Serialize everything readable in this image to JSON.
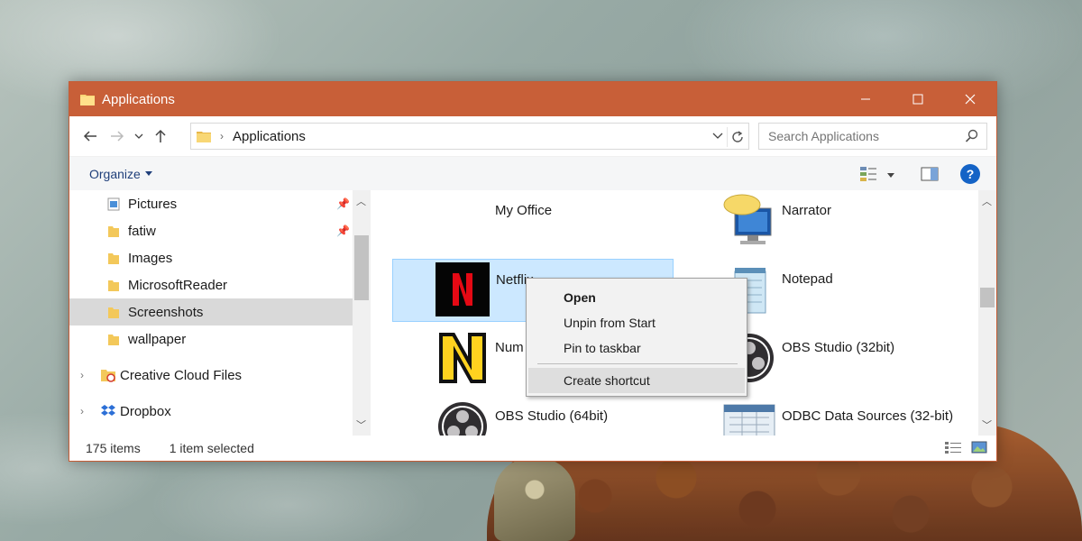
{
  "window": {
    "title": "Applications",
    "accent": "#c85f38"
  },
  "nav": {
    "back_icon": "back-arrow-icon",
    "forward_icon": "forward-arrow-icon",
    "recent_icon": "chevron-down-icon",
    "up_icon": "up-arrow-icon",
    "address_crumb": "Applications",
    "search_placeholder": "Search Applications"
  },
  "command_bar": {
    "organize_label": "Organize"
  },
  "sidebar": {
    "items": [
      {
        "label": "Pictures",
        "pinned": true
      },
      {
        "label": "fatiw",
        "pinned": true
      },
      {
        "label": "Images",
        "pinned": false
      },
      {
        "label": "MicrosoftReader",
        "pinned": false
      },
      {
        "label": "Screenshots",
        "pinned": false,
        "selected": true
      },
      {
        "label": "wallpaper",
        "pinned": false
      }
    ],
    "roots": [
      {
        "label": "Creative Cloud Files"
      },
      {
        "label": "Dropbox"
      }
    ]
  },
  "content": {
    "tiles": [
      {
        "label": "My Office",
        "icon": "none"
      },
      {
        "label": "Narrator",
        "icon": "narrator-icon"
      },
      {
        "label": "Netflix",
        "icon": "netflix-icon",
        "selected": true
      },
      {
        "label": "Notepad",
        "icon": "notepad-icon"
      },
      {
        "label": "Num",
        "icon": "numbers-app-icon"
      },
      {
        "label": "OBS Studio (32bit)",
        "icon": "obs-icon"
      },
      {
        "label": "OBS Studio (64bit)",
        "icon": "obs-icon"
      },
      {
        "label": "ODBC Data Sources (32-bit)",
        "icon": "odbc-icon"
      }
    ]
  },
  "context_menu": {
    "items": [
      {
        "label": "Open",
        "bold": true
      },
      {
        "label": "Unpin from Start"
      },
      {
        "label": "Pin to taskbar"
      },
      {
        "label": "Create shortcut",
        "hovered": true
      }
    ]
  },
  "status": {
    "item_count": "175 items",
    "selection": "1 item selected"
  }
}
